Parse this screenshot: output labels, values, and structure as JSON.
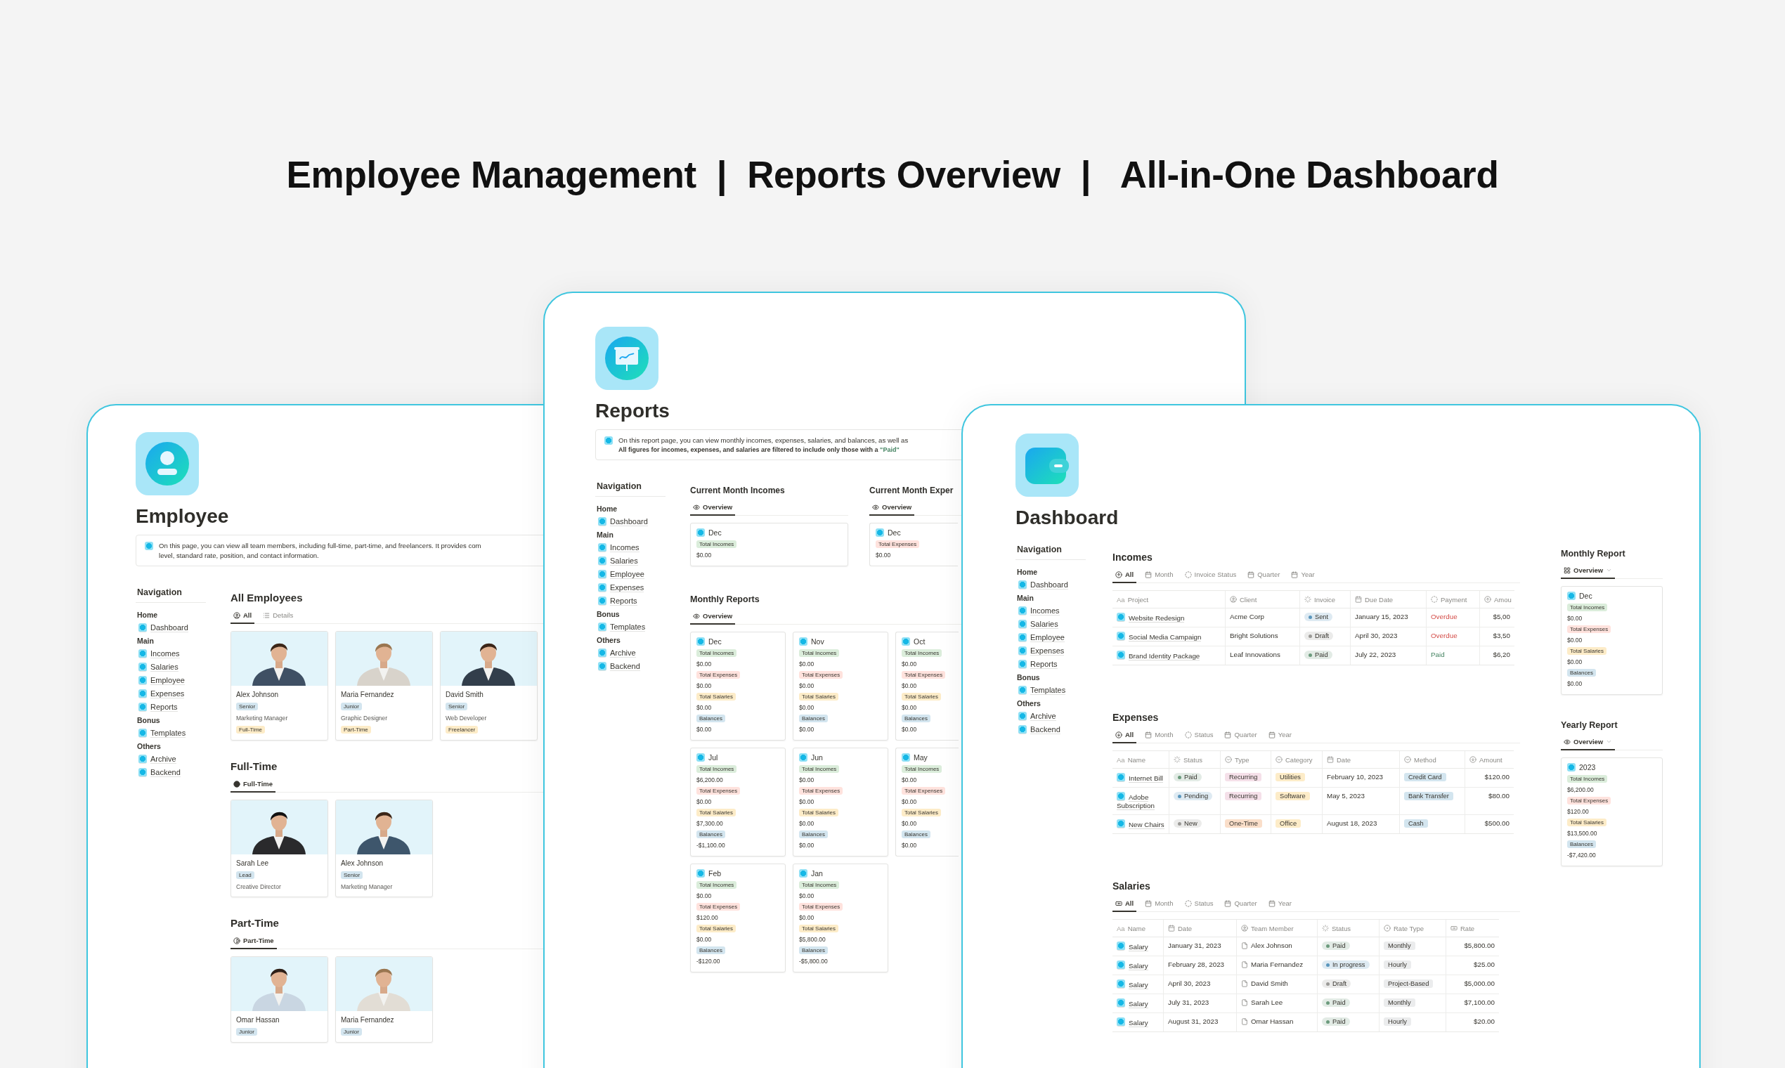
{
  "headline": "Employee Management  |  Reports Overview  |   All-in-One Dashboard",
  "employee": {
    "title": "Employee",
    "callout": [
      "On this page, you can view all team members, including full-time, part-time, and freelancers. It provides com",
      "level, standard rate, position, and contact information."
    ],
    "navigation": {
      "heading": "Navigation",
      "groups": [
        {
          "label": "Home",
          "items": [
            "Dashboard"
          ]
        },
        {
          "label": "Main",
          "items": [
            "Incomes",
            "Salaries",
            "Employee",
            "Expenses",
            "Reports"
          ]
        },
        {
          "label": "Bonus",
          "items": [
            "Templates"
          ]
        },
        {
          "label": "Others",
          "items": [
            "Archive",
            "Backend"
          ]
        }
      ]
    },
    "sections": [
      {
        "title": "All Employees",
        "views": [
          {
            "label": "All",
            "kind": "user",
            "selected": true
          },
          {
            "label": "Details",
            "kind": "list",
            "selected": false
          }
        ],
        "cards": [
          {
            "name": "Alex Johnson",
            "seniority": "Senior",
            "position": "Marketing Manager",
            "type": "Full-Time"
          },
          {
            "name": "Maria Fernandez",
            "seniority": "Junior",
            "position": "Graphic Designer",
            "type": "Part-Time"
          },
          {
            "name": "David Smith",
            "seniority": "Senior",
            "position": "Web Developer",
            "type": "Freelancer"
          }
        ]
      },
      {
        "title": "Full-Time",
        "views": [
          {
            "label": "Full-Time",
            "kind": "dot",
            "selected": true
          }
        ],
        "cards": [
          {
            "name": "Sarah Lee",
            "seniority": "Lead",
            "position": "Creative Director"
          },
          {
            "name": "Alex Johnson",
            "seniority": "Senior",
            "position": "Marketing Manager"
          }
        ]
      },
      {
        "title": "Part-Time",
        "views": [
          {
            "label": "Part-Time",
            "kind": "half",
            "selected": true
          }
        ],
        "cards": [
          {
            "name": "Omar Hassan",
            "seniority": "Junior"
          },
          {
            "name": "Maria Fernandez",
            "seniority": "Junior"
          }
        ]
      }
    ]
  },
  "reports": {
    "title": "Reports",
    "callout": {
      "line_1": "On this report page, you can view monthly incomes, expenses, salaries, and balances, as well as",
      "line_2": "All figures for incomes, expenses, and salaries are filtered to include only those with a ",
      "line_2_highlight": "\"Paid\""
    },
    "navigation": {
      "heading": "Navigation",
      "groups": [
        {
          "label": "Home",
          "items": [
            "Dashboard"
          ]
        },
        {
          "label": "Main",
          "items": [
            "Incomes",
            "Salaries",
            "Employee",
            "Expenses",
            "Reports"
          ]
        },
        {
          "label": "Bonus",
          "items": [
            "Templates"
          ]
        },
        {
          "label": "Others",
          "items": [
            "Archive",
            "Backend"
          ]
        }
      ]
    },
    "current": [
      {
        "title": "Current Month Incomes",
        "views": [
          {
            "label": "Overview",
            "kind": "eye",
            "selected": true
          }
        ],
        "cards": [
          {
            "title": "Dec",
            "metrics": [
              {
                "kind": "incomes",
                "label": "Total Incomes",
                "value": "$0.00"
              }
            ]
          }
        ]
      },
      {
        "title": "Current Month Exper",
        "views": [
          {
            "label": "Overview",
            "kind": "eye",
            "selected": true
          }
        ],
        "cards": [
          {
            "title": "Dec",
            "metrics": [
              {
                "kind": "expenses",
                "label": "Total Expenses",
                "value": "$0.00"
              }
            ]
          }
        ]
      }
    ],
    "monthly": {
      "title": "Monthly Reports",
      "views": [
        {
          "label": "Overview",
          "kind": "eye",
          "selected": true
        }
      ],
      "cards": [
        {
          "title": "Dec",
          "metrics": [
            {
              "kind": "incomes",
              "label": "Total Incomes",
              "value": "$0.00"
            },
            {
              "kind": "expenses",
              "label": "Total Expenses",
              "value": "$0.00"
            },
            {
              "kind": "salaries",
              "label": "Total Salaries",
              "value": "$0.00"
            },
            {
              "kind": "balances",
              "label": "Balances",
              "value": "$0.00"
            }
          ]
        },
        {
          "title": "Nov",
          "metrics": [
            {
              "kind": "incomes",
              "label": "Total Incomes",
              "value": "$0.00"
            },
            {
              "kind": "expenses",
              "label": "Total Expenses",
              "value": "$0.00"
            },
            {
              "kind": "salaries",
              "label": "Total Salaries",
              "value": "$0.00"
            },
            {
              "kind": "balances",
              "label": "Balances",
              "value": "$0.00"
            }
          ]
        },
        {
          "title": "Oct",
          "metrics": [
            {
              "kind": "incomes",
              "label": "Total Incomes",
              "value": "$0.00"
            },
            {
              "kind": "expenses",
              "label": "Total Expenses",
              "value": "$0.00"
            },
            {
              "kind": "salaries",
              "label": "Total Salaries",
              "value": "$0.00"
            },
            {
              "kind": "balances",
              "label": "Balances",
              "value": "$0.00"
            }
          ]
        },
        {
          "title": "Jul",
          "metrics": [
            {
              "kind": "incomes",
              "label": "Total Incomes",
              "value": "$6,200.00"
            },
            {
              "kind": "expenses",
              "label": "Total Expenses",
              "value": "$0.00"
            },
            {
              "kind": "salaries",
              "label": "Total Salaries",
              "value": "$7,300.00"
            },
            {
              "kind": "balances",
              "label": "Balances",
              "value": "-$1,100.00"
            }
          ]
        },
        {
          "title": "Jun",
          "metrics": [
            {
              "kind": "incomes",
              "label": "Total Incomes",
              "value": "$0.00"
            },
            {
              "kind": "expenses",
              "label": "Total Expenses",
              "value": "$0.00"
            },
            {
              "kind": "salaries",
              "label": "Total Salaries",
              "value": "$0.00"
            },
            {
              "kind": "balances",
              "label": "Balances",
              "value": "$0.00"
            }
          ]
        },
        {
          "title": "May",
          "metrics": [
            {
              "kind": "incomes",
              "label": "Total Incomes",
              "value": "$0.00"
            },
            {
              "kind": "expenses",
              "label": "Total Expenses",
              "value": "$0.00"
            },
            {
              "kind": "salaries",
              "label": "Total Salaries",
              "value": "$0.00"
            },
            {
              "kind": "balances",
              "label": "Balances",
              "value": "$0.00"
            }
          ]
        },
        {
          "title": "Feb",
          "metrics": [
            {
              "kind": "incomes",
              "label": "Total Incomes",
              "value": "$0.00"
            },
            {
              "kind": "expenses",
              "label": "Total Expenses",
              "value": "$120.00"
            },
            {
              "kind": "salaries",
              "label": "Total Salaries",
              "value": "$0.00"
            },
            {
              "kind": "balances",
              "label": "Balances",
              "value": "-$120.00"
            }
          ]
        },
        {
          "title": "Jan",
          "metrics": [
            {
              "kind": "incomes",
              "label": "Total Incomes",
              "value": "$0.00"
            },
            {
              "kind": "expenses",
              "label": "Total Expenses",
              "value": "$0.00"
            },
            {
              "kind": "salaries",
              "label": "Total Salaries",
              "value": "$5,800.00"
            },
            {
              "kind": "balances",
              "label": "Balances",
              "value": "-$5,800.00"
            }
          ]
        }
      ]
    }
  },
  "dashboard": {
    "title": "Dashboard",
    "navigation": {
      "heading": "Navigation",
      "groups": [
        {
          "label": "Home",
          "items": [
            "Dashboard"
          ]
        },
        {
          "label": "Main",
          "items": [
            "Incomes",
            "Salaries",
            "Employee",
            "Expenses",
            "Reports"
          ]
        },
        {
          "label": "Bonus",
          "items": [
            "Templates"
          ]
        },
        {
          "label": "Others",
          "items": [
            "Archive",
            "Backend"
          ]
        }
      ]
    },
    "tables": [
      {
        "kind": "incomes",
        "title": "Incomes",
        "views": [
          {
            "label": "All",
            "kind": "up",
            "selected": true
          },
          {
            "label": "Month",
            "kind": "calendar",
            "selected": false
          },
          {
            "label": "Invoice Status",
            "kind": "status",
            "selected": false
          },
          {
            "label": "Quarter",
            "kind": "calendar",
            "selected": false
          },
          {
            "label": "Year",
            "kind": "calendar",
            "selected": false
          }
        ],
        "columns": [
          {
            "label": "Project",
            "marker": "Aa"
          },
          {
            "label": "Client",
            "kind": "person"
          },
          {
            "label": "Invoice",
            "kind": "spinner"
          },
          {
            "label": "Due Date",
            "kind": "calendar"
          },
          {
            "label": "Payment",
            "kind": "status"
          },
          {
            "label": "Amou",
            "kind": "up"
          }
        ],
        "rows": [
          [
            {
              "kind": "title",
              "text": "Website Redesign"
            },
            {
              "kind": "text",
              "text": "Acme Corp"
            },
            {
              "kind": "status",
              "text": "Sent",
              "color": "#5b97bd"
            },
            {
              "kind": "text",
              "text": "January 15, 2023"
            },
            {
              "kind": "colored",
              "text": "Overdue",
              "color": "#d44c47"
            },
            {
              "kind": "number",
              "text": "$5,00"
            }
          ],
          [
            {
              "kind": "title",
              "text": "Social Media Campaign"
            },
            {
              "kind": "text",
              "text": "Bright Solutions"
            },
            {
              "kind": "status",
              "text": "Draft",
              "color": "#9b9a97"
            },
            {
              "kind": "text",
              "text": "April 30, 2023"
            },
            {
              "kind": "colored",
              "text": "Overdue",
              "color": "#d44c47"
            },
            {
              "kind": "number",
              "text": "$3,50"
            }
          ],
          [
            {
              "kind": "title",
              "text": "Brand Identity Package"
            },
            {
              "kind": "text",
              "text": "Leaf Innovations"
            },
            {
              "kind": "status",
              "text": "Paid",
              "color": "#6c9b7d"
            },
            {
              "kind": "text",
              "text": "July 22, 2023"
            },
            {
              "kind": "colored",
              "text": "Paid",
              "color": "#448361"
            },
            {
              "kind": "number",
              "text": "$6,20"
            }
          ]
        ]
      },
      {
        "kind": "expenses",
        "title": "Expenses",
        "views": [
          {
            "label": "All",
            "kind": "down",
            "selected": true
          },
          {
            "label": "Month",
            "kind": "calendar",
            "selected": false
          },
          {
            "label": "Status",
            "kind": "status",
            "selected": false
          },
          {
            "label": "Quarter",
            "kind": "calendar",
            "selected": false
          },
          {
            "label": "Year",
            "kind": "calendar",
            "selected": false
          }
        ],
        "columns": [
          {
            "label": "Name",
            "marker": "Aa"
          },
          {
            "label": "Status",
            "kind": "spinner"
          },
          {
            "label": "Type",
            "kind": "select"
          },
          {
            "label": "Category",
            "kind": "select"
          },
          {
            "label": "Date",
            "kind": "calendar"
          },
          {
            "label": "Method",
            "kind": "select"
          },
          {
            "label": "Amount",
            "kind": "down"
          }
        ],
        "rows": [
          [
            {
              "kind": "title",
              "text": "Internet Bill"
            },
            {
              "kind": "status",
              "text": "Paid",
              "color": "#6c9b7d"
            },
            {
              "kind": "tag",
              "text": "Recurring",
              "color": "#f5e0e9"
            },
            {
              "kind": "tag",
              "text": "Utilities",
              "color": "#fdecc8"
            },
            {
              "kind": "text",
              "text": "February 10, 2023"
            },
            {
              "kind": "tag",
              "text": "Credit Card",
              "color": "#d3e5ef"
            },
            {
              "kind": "number",
              "text": "$120.00"
            }
          ],
          [
            {
              "kind": "title",
              "text": "Adobe Subscription"
            },
            {
              "kind": "status",
              "text": "Pending",
              "color": "#5b97bd"
            },
            {
              "kind": "tag",
              "text": "Recurring",
              "color": "#f5e0e9"
            },
            {
              "kind": "tag",
              "text": "Software",
              "color": "#fdecc8"
            },
            {
              "kind": "text",
              "text": "May 5, 2023"
            },
            {
              "kind": "tag",
              "text": "Bank Transfer",
              "color": "#d3e5ef"
            },
            {
              "kind": "number",
              "text": "$80.00"
            }
          ],
          [
            {
              "kind": "title",
              "text": "New Chairs"
            },
            {
              "kind": "status",
              "text": "New",
              "color": "#9b9a97"
            },
            {
              "kind": "tag",
              "text": "One-Time",
              "color": "#fadec9"
            },
            {
              "kind": "tag",
              "text": "Office",
              "color": "#fdecc8"
            },
            {
              "kind": "text",
              "text": "August 18, 2023"
            },
            {
              "kind": "tag",
              "text": "Cash",
              "color": "#d3e5ef"
            },
            {
              "kind": "number",
              "text": "$500.00"
            }
          ]
        ]
      },
      {
        "kind": "salaries",
        "title": "Salaries",
        "views": [
          {
            "label": "All",
            "kind": "money",
            "selected": true
          },
          {
            "label": "Month",
            "kind": "calendar",
            "selected": false
          },
          {
            "label": "Status",
            "kind": "status",
            "selected": false
          },
          {
            "label": "Quarter",
            "kind": "calendar",
            "selected": false
          },
          {
            "label": "Year",
            "kind": "calendar",
            "selected": false
          }
        ],
        "columns": [
          {
            "label": "Name",
            "marker": "Aa"
          },
          {
            "label": "Date",
            "kind": "calendar"
          },
          {
            "label": "Team Member",
            "kind": "person"
          },
          {
            "label": "Status",
            "kind": "spinner"
          },
          {
            "label": "Rate Type",
            "kind": "ring"
          },
          {
            "label": "Rate",
            "kind": "money"
          }
        ],
        "rows": [
          [
            {
              "kind": "title",
              "text": "Salary"
            },
            {
              "kind": "text",
              "text": "January 31, 2023"
            },
            {
              "kind": "member",
              "text": "Alex Johnson"
            },
            {
              "kind": "status",
              "text": "Paid",
              "color": "#6c9b7d"
            },
            {
              "kind": "tag",
              "text": "Monthly",
              "color": "#ebeced"
            },
            {
              "kind": "number",
              "text": "$5,800.00"
            }
          ],
          [
            {
              "kind": "title",
              "text": "Salary"
            },
            {
              "kind": "text",
              "text": "February 28, 2023"
            },
            {
              "kind": "member",
              "text": "Maria Fernandez"
            },
            {
              "kind": "status",
              "text": "In progress",
              "color": "#5b97bd"
            },
            {
              "kind": "tag",
              "text": "Hourly",
              "color": "#ebeced"
            },
            {
              "kind": "number",
              "text": "$25.00"
            }
          ],
          [
            {
              "kind": "title",
              "text": "Salary"
            },
            {
              "kind": "text",
              "text": "April 30, 2023"
            },
            {
              "kind": "member",
              "text": "David Smith"
            },
            {
              "kind": "status",
              "text": "Draft",
              "color": "#9b9a97"
            },
            {
              "kind": "tag",
              "text": "Project-Based",
              "color": "#ebeced"
            },
            {
              "kind": "number",
              "text": "$5,000.00"
            }
          ],
          [
            {
              "kind": "title",
              "text": "Salary"
            },
            {
              "kind": "text",
              "text": "July 31, 2023"
            },
            {
              "kind": "member",
              "text": "Sarah Lee"
            },
            {
              "kind": "status",
              "text": "Paid",
              "color": "#6c9b7d"
            },
            {
              "kind": "tag",
              "text": "Monthly",
              "color": "#ebeced"
            },
            {
              "kind": "number",
              "text": "$7,100.00"
            }
          ],
          [
            {
              "kind": "title",
              "text": "Salary"
            },
            {
              "kind": "text",
              "text": "August 31, 2023"
            },
            {
              "kind": "member",
              "text": "Omar Hassan"
            },
            {
              "kind": "status",
              "text": "Paid",
              "color": "#6c9b7d"
            },
            {
              "kind": "tag",
              "text": "Hourly",
              "color": "#ebeced"
            },
            {
              "kind": "number",
              "text": "$20.00"
            }
          ]
        ]
      }
    ],
    "reports": [
      {
        "title": "Monthly Report",
        "views": [
          {
            "label": "Overview",
            "kind": "grid",
            "selected": true
          }
        ],
        "cards": [
          {
            "title": "Dec",
            "metrics": [
              {
                "kind": "incomes",
                "label": "Total Incomes",
                "value": "$0.00"
              },
              {
                "kind": "expenses",
                "label": "Total Expenses",
                "value": "$0.00"
              },
              {
                "kind": "salaries",
                "label": "Total Salaries",
                "value": "$0.00"
              },
              {
                "kind": "balances",
                "label": "Balances",
                "value": "$0.00"
              }
            ]
          }
        ]
      },
      {
        "title": "Yearly Report",
        "views": [
          {
            "label": "Overview",
            "kind": "eye",
            "selected": true
          }
        ],
        "cards": [
          {
            "title": "2023",
            "metrics": [
              {
                "kind": "incomes",
                "label": "Total Incomes",
                "value": "$6,200.00"
              },
              {
                "kind": "expenses",
                "label": "Total Expenses",
                "value": "$120.00"
              },
              {
                "kind": "salaries",
                "label": "Total Salaries",
                "value": "$13,500.00"
              },
              {
                "kind": "balances",
                "label": "Balances",
                "value": "-$7,420.00"
              }
            ]
          }
        ]
      }
    ]
  }
}
